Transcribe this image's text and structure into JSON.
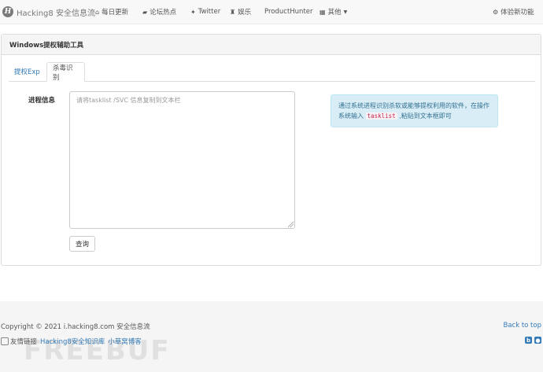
{
  "navbar": {
    "brand_logo": "H",
    "brand": "Hacking8 安全信息流",
    "items": [
      {
        "label": "每日更新",
        "icon": "home-icon"
      },
      {
        "label": "论坛热点",
        "icon": "comments-icon"
      },
      {
        "label": "Twitter",
        "icon": "twitter-icon"
      },
      {
        "label": "娱乐",
        "icon": "user-icon"
      },
      {
        "label": "ProductHunter",
        "icon": ""
      },
      {
        "label": "其他",
        "icon": "grid-icon"
      }
    ],
    "new_feature": "体验新功能"
  },
  "panel": {
    "title": "Windows提权辅助工具",
    "tabs": [
      "提权Exp",
      "杀毒识别"
    ],
    "active_tab": "杀毒识别",
    "field_label": "进程信息",
    "textarea_placeholder": "请将tasklist /SVC 信息复制到文本栏",
    "query_button": "查询",
    "info": {
      "prefix": "通过系统进程识别杀软或能够提权利用的软件，在操作系统输入 ",
      "code": "tasklist",
      "suffix": " ,粘贴到文本框即可"
    }
  },
  "footer": {
    "copyright": "Copyright © 2021 i.hacking8.com 安全信息流",
    "back_to_top": "Back to top",
    "links_label": "友情链接",
    "links": [
      "Hacking8安全知识库",
      "小草窝博客"
    ],
    "watermark": "FREEBUF"
  }
}
